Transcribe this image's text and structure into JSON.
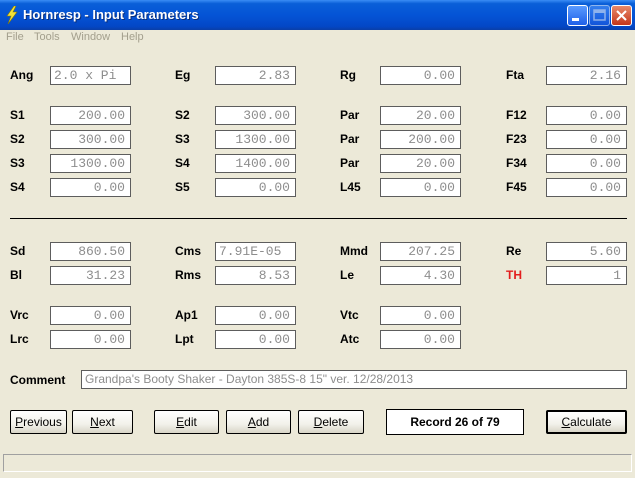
{
  "window": {
    "title": "Hornresp - Input Parameters"
  },
  "menu": [
    "File",
    "Tools",
    "Window",
    "Help"
  ],
  "fields": {
    "ang": {
      "label": "Ang",
      "value": "2.0 x Pi"
    },
    "eg": {
      "label": "Eg",
      "value": "2.83"
    },
    "rg": {
      "label": "Rg",
      "value": "0.00"
    },
    "fta": {
      "label": "Fta",
      "value": "2.16"
    },
    "s1": {
      "label": "S1",
      "value": "200.00"
    },
    "s2a": {
      "label": "S2",
      "value": "300.00"
    },
    "par1": {
      "label": "Par",
      "value": "20.00"
    },
    "f12": {
      "label": "F12",
      "value": "0.00"
    },
    "s2b": {
      "label": "S2",
      "value": "300.00"
    },
    "s3a": {
      "label": "S3",
      "value": "1300.00"
    },
    "par2": {
      "label": "Par",
      "value": "200.00"
    },
    "f23": {
      "label": "F23",
      "value": "0.00"
    },
    "s3b": {
      "label": "S3",
      "value": "1300.00"
    },
    "s4a": {
      "label": "S4",
      "value": "1400.00"
    },
    "par3": {
      "label": "Par",
      "value": "20.00"
    },
    "f34": {
      "label": "F34",
      "value": "0.00"
    },
    "s4b": {
      "label": "S4",
      "value": "0.00"
    },
    "s5": {
      "label": "S5",
      "value": "0.00"
    },
    "l45": {
      "label": "L45",
      "value": "0.00"
    },
    "f45": {
      "label": "F45",
      "value": "0.00"
    },
    "sd": {
      "label": "Sd",
      "value": "860.50"
    },
    "cms": {
      "label": "Cms",
      "value": "7.91E-05"
    },
    "mmd": {
      "label": "Mmd",
      "value": "207.25"
    },
    "re": {
      "label": "Re",
      "value": "5.60"
    },
    "bl": {
      "label": "Bl",
      "value": "31.23"
    },
    "rms": {
      "label": "Rms",
      "value": "8.53"
    },
    "le": {
      "label": "Le",
      "value": "4.30"
    },
    "th": {
      "label": "TH",
      "value": "1"
    },
    "vrc": {
      "label": "Vrc",
      "value": "0.00"
    },
    "ap1": {
      "label": "Ap1",
      "value": "0.00"
    },
    "vtc": {
      "label": "Vtc",
      "value": "0.00"
    },
    "lrc": {
      "label": "Lrc",
      "value": "0.00"
    },
    "lpt": {
      "label": "Lpt",
      "value": "0.00"
    },
    "atc": {
      "label": "Atc",
      "value": "0.00"
    }
  },
  "comment": {
    "label": "Comment",
    "value": "Grandpa's Booty Shaker - Dayton 385S-8  15\"  ver. 12/28/2013"
  },
  "buttons": {
    "previous": {
      "pre": "",
      "key": "P",
      "post": "revious"
    },
    "next": {
      "pre": "",
      "key": "N",
      "post": "ext"
    },
    "edit": {
      "pre": "",
      "key": "E",
      "post": "dit"
    },
    "add": {
      "pre": "",
      "key": "A",
      "post": "dd"
    },
    "delete": {
      "pre": "",
      "key": "D",
      "post": "elete"
    },
    "calculate": {
      "pre": "",
      "key": "C",
      "post": "alculate"
    }
  },
  "record_text": "Record 26 of 79",
  "colors": {
    "titlebar": "#0454d6",
    "th_label": "#e31d1d",
    "field_text": "#8d8d8d"
  },
  "icons": [
    "lightning-icon",
    "minimize-icon",
    "maximize-icon",
    "close-icon"
  ]
}
